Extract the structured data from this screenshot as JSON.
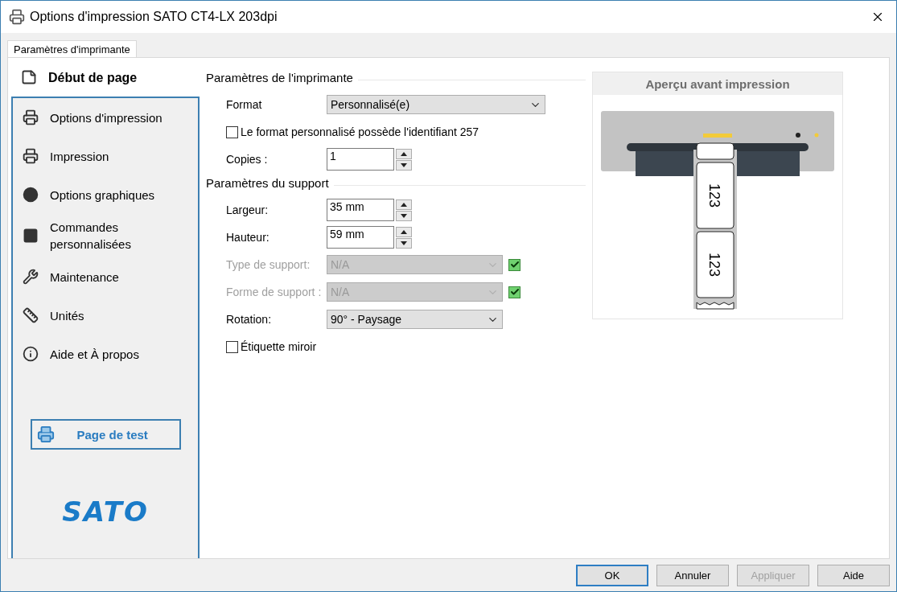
{
  "window": {
    "title": "Options d'impression SATO CT4-LX 203dpi"
  },
  "tabs": [
    {
      "label": "Paramètres d'imprimante",
      "selected": true
    }
  ],
  "sidebar": {
    "items": [
      {
        "label": "Début de page",
        "selected": true
      },
      {
        "label": "Options d'impression",
        "selected": false
      },
      {
        "label": "Impression",
        "selected": false
      },
      {
        "label": "Options graphiques",
        "selected": false
      },
      {
        "label": "Commandes personnalisées",
        "selected": false
      },
      {
        "label": "Maintenance",
        "selected": false
      },
      {
        "label": "Unités",
        "selected": false
      },
      {
        "label": "Aide et À propos",
        "selected": false
      }
    ],
    "test_button": "Page de test",
    "logo": "SATO"
  },
  "sections": [
    {
      "title": "Paramètres de l'imprimante",
      "fields": [
        {
          "kind": "select",
          "label": "Format",
          "value": "Personnalisé(e)",
          "disabled": false
        },
        {
          "kind": "checkbox",
          "label": "Le format personnalisé possède l'identifiant 257",
          "checked": false
        },
        {
          "kind": "spin",
          "label": "Copies :",
          "value": "1"
        }
      ]
    },
    {
      "title": "Paramètres du support",
      "fields": [
        {
          "kind": "spin",
          "label": "Largeur:",
          "value": "35 mm"
        },
        {
          "kind": "spin",
          "label": "Hauteur:",
          "value": "59 mm"
        },
        {
          "kind": "select",
          "label": "Type de support:",
          "value": "N/A",
          "disabled": true,
          "auto": true
        },
        {
          "kind": "select",
          "label": "Forme de support :",
          "value": "N/A",
          "disabled": true,
          "auto": true
        },
        {
          "kind": "select",
          "label": "Rotation:",
          "value": "90° - Paysage",
          "disabled": false
        },
        {
          "kind": "checkbox",
          "label": "Étiquette miroir",
          "checked": false
        }
      ]
    }
  ],
  "preview": {
    "title": "Aperçu avant impression",
    "labels": [
      "123",
      "123"
    ]
  },
  "buttons": [
    {
      "label": "OK",
      "default": true,
      "disabled": false
    },
    {
      "label": "Annuler",
      "default": false,
      "disabled": false
    },
    {
      "label": "Appliquer",
      "default": false,
      "disabled": true
    },
    {
      "label": "Aide",
      "default": false,
      "disabled": false
    }
  ]
}
